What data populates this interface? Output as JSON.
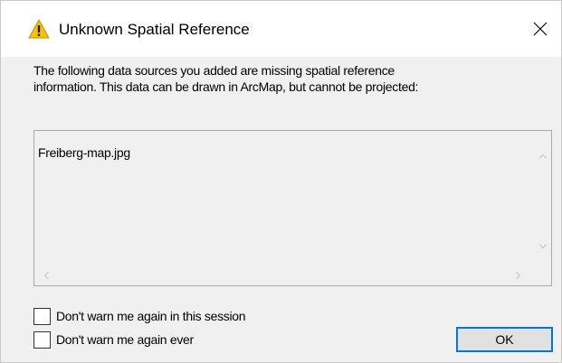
{
  "dialog": {
    "title": "Unknown Spatial Reference",
    "title_icon": "warning-icon",
    "close_icon": "close-icon",
    "message_line1": "The following data sources you added are missing spatial reference",
    "message_line2": "information. This data can be drawn in ArcMap, but cannot be projected:",
    "list_items": [
      "Freiberg-map.jpg"
    ],
    "checkbox_session_label": "Don't warn me again in this session",
    "checkbox_ever_label": "Don't warn me again ever",
    "checkbox_session_checked": false,
    "checkbox_ever_checked": false,
    "ok_label": "OK"
  },
  "colors": {
    "warning_fill": "#f5c400",
    "accent_border": "#0078d7",
    "dialog_bg": "#f0f0f0",
    "titlebar_bg": "#ffffff"
  }
}
